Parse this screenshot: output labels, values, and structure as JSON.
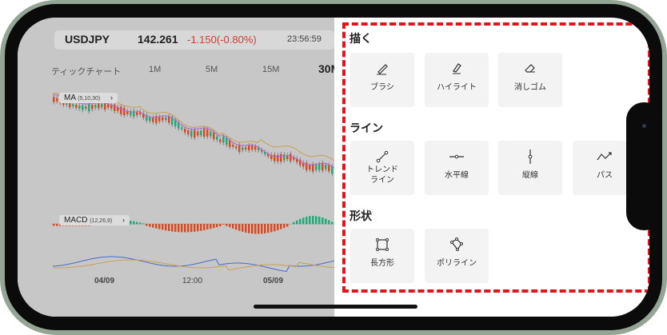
{
  "ticker": {
    "symbol": "USDJPY",
    "price": "142.261",
    "change": "-1.150(-0.80%)",
    "time": "23:56:59"
  },
  "periods": [
    "ティックチャート",
    "1M",
    "5M",
    "15M",
    "30M"
  ],
  "selected_period": "30M",
  "indicators": {
    "ma": {
      "name": "MA",
      "params": "(5,10,30)",
      "chevron": "›"
    },
    "macd": {
      "name": "MACD",
      "params": "(12,26,9)",
      "chevron": "›"
    }
  },
  "dates": [
    "04/09",
    "12:00",
    "05/09"
  ],
  "colors": {
    "highlight_border": "#e3151c",
    "bear": "#c9502e",
    "bull": "#2ea37a"
  },
  "panel": {
    "sections": [
      {
        "title": "描く",
        "tools": [
          {
            "label": "ブラシ",
            "icon": "brush-icon"
          },
          {
            "label": "ハイライト",
            "icon": "highlighter-icon"
          },
          {
            "label": "消しゴム",
            "icon": "eraser-icon"
          }
        ]
      },
      {
        "title": "ライン",
        "tools": [
          {
            "label": "トレンド\nライン",
            "icon": "trend-line-icon"
          },
          {
            "label": "水平線",
            "icon": "horizontal-line-icon"
          },
          {
            "label": "縦線",
            "icon": "vertical-line-icon"
          },
          {
            "label": "パス",
            "icon": "path-icon"
          }
        ]
      },
      {
        "title": "形状",
        "tools": [
          {
            "label": "長方形",
            "icon": "rectangle-icon"
          },
          {
            "label": "ポリライン",
            "icon": "polyline-icon"
          }
        ]
      }
    ]
  }
}
